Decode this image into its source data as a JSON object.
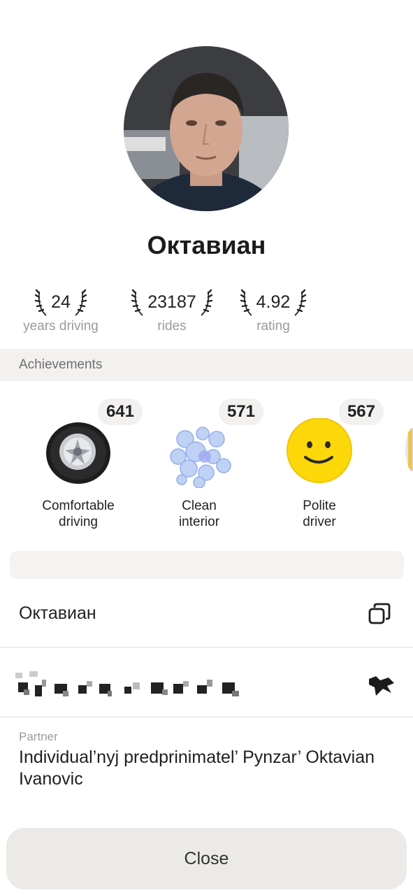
{
  "profile": {
    "name": "Октавиан"
  },
  "stats": [
    {
      "value": "24",
      "caption": "years driving"
    },
    {
      "value": "23187",
      "caption": "rides"
    },
    {
      "value": "4.92",
      "caption": "rating"
    }
  ],
  "achievements": {
    "title": "Achievements",
    "items": [
      {
        "count": "641",
        "label": "Comfortable driving",
        "icon": "tire-icon"
      },
      {
        "count": "571",
        "label": "Clean interior",
        "icon": "bubbles-icon"
      },
      {
        "count": "567",
        "label": "Polite driver",
        "icon": "smiley-icon"
      }
    ]
  },
  "details": {
    "name_value": "Октавиан",
    "partner_label": "Partner",
    "partner_value": "Individual’nyj predprinimatel’ Pynzar’ Oktavian Ivanovic"
  },
  "footer": {
    "close_label": "Close"
  },
  "colors": {
    "section_bg": "#f2f1ef",
    "button_bg": "#eceae6",
    "smiley_yellow": "#fcd80a"
  }
}
